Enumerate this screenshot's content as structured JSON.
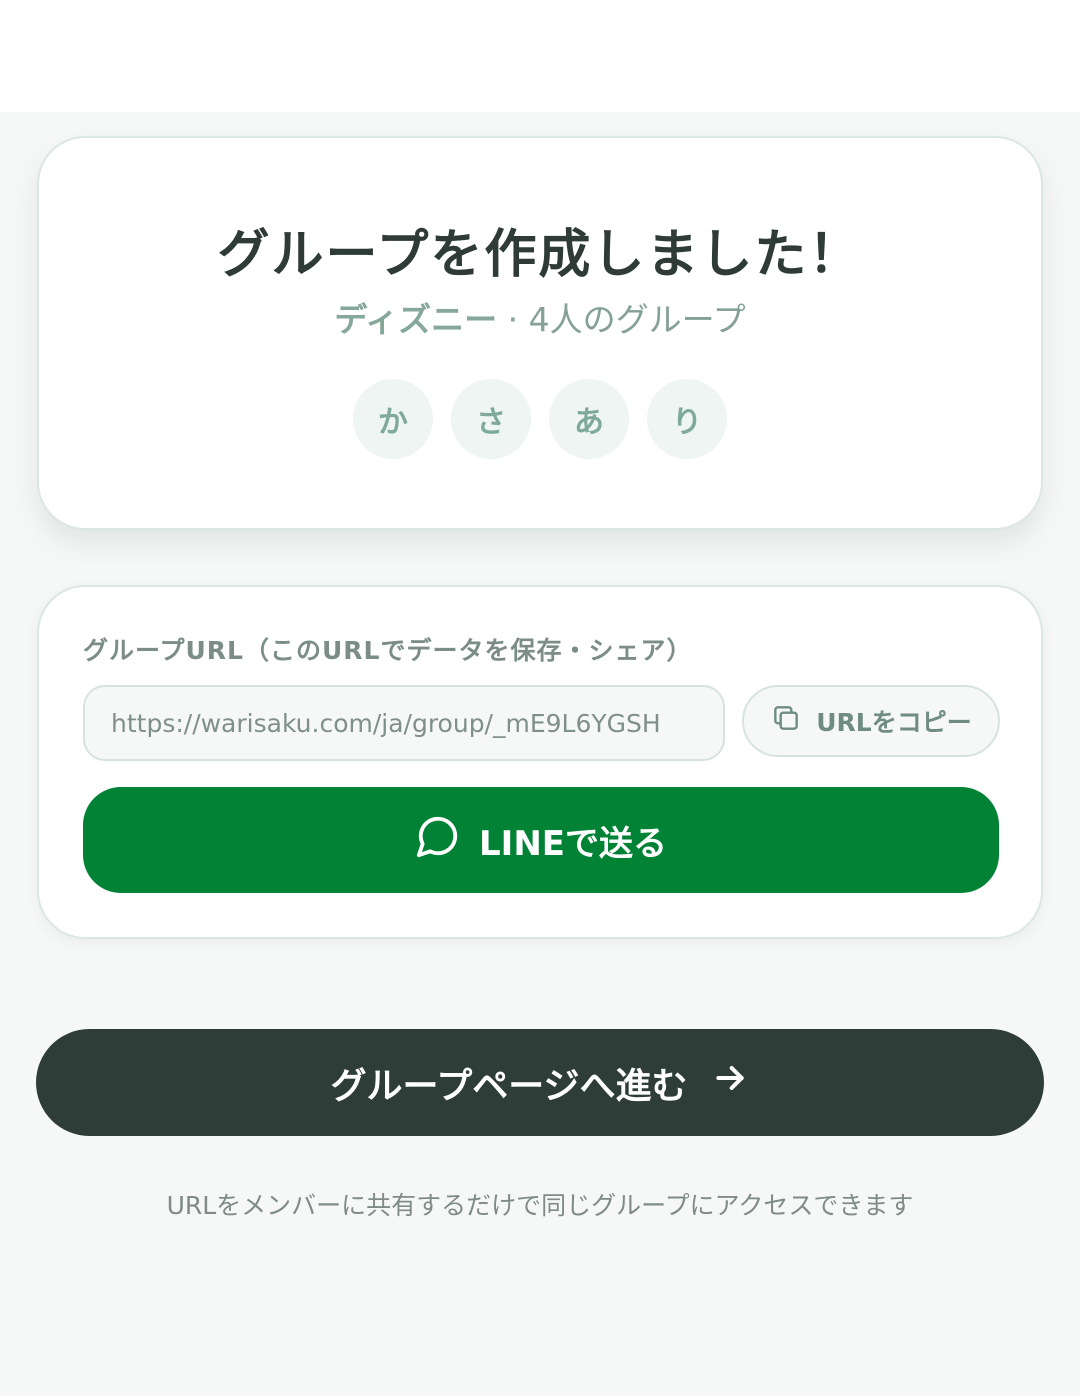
{
  "created_card": {
    "title": "グループを作成しました！",
    "group_name": "ディズニー",
    "separator": "·",
    "member_summary": "4人のグループ",
    "members": [
      "か",
      "さ",
      "あ",
      "り"
    ]
  },
  "share_card": {
    "label": "グループURL（このURLでデータを保存・シェア）",
    "url_value": "https://warisaku.com/ja/group/_mE9L6YGSH",
    "copy_label": "URLをコピー",
    "line_label": "LINEで送る"
  },
  "proceed_label": "グループページへ進む",
  "footnote": "URLをメンバーに共有するだけで同じグループにアクセスできます",
  "colors": {
    "line_green": "#028235",
    "dark_button": "#2e3d38",
    "accent_text": "#86a89b"
  },
  "icons": [
    "copy-icon",
    "chat-bubble-icon",
    "arrow-right-icon"
  ]
}
